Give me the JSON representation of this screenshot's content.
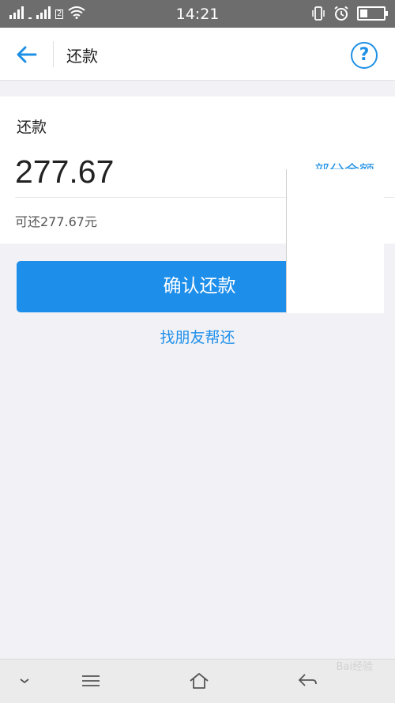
{
  "status": {
    "time": "14:21",
    "sim_label": "2"
  },
  "header": {
    "title": "还款",
    "help_label": "?"
  },
  "card": {
    "label": "还款",
    "amount": "277.67",
    "partial_link": "部分金额",
    "available": "可还277.67元"
  },
  "actions": {
    "confirm_label": "确认还款",
    "friend_label": "找朋友帮还"
  },
  "watermark": {
    "text": "Bai经验"
  },
  "colors": {
    "accent": "#1d8eea",
    "status_bar": "#6d6d6d",
    "background": "#f2f2f6"
  },
  "icons": {
    "back": "arrow-left-icon",
    "help": "question-circle-icon",
    "collapse": "chevron-down-icon",
    "menu": "menu-lines-icon",
    "home": "home-icon",
    "return": "return-arrow-icon"
  }
}
